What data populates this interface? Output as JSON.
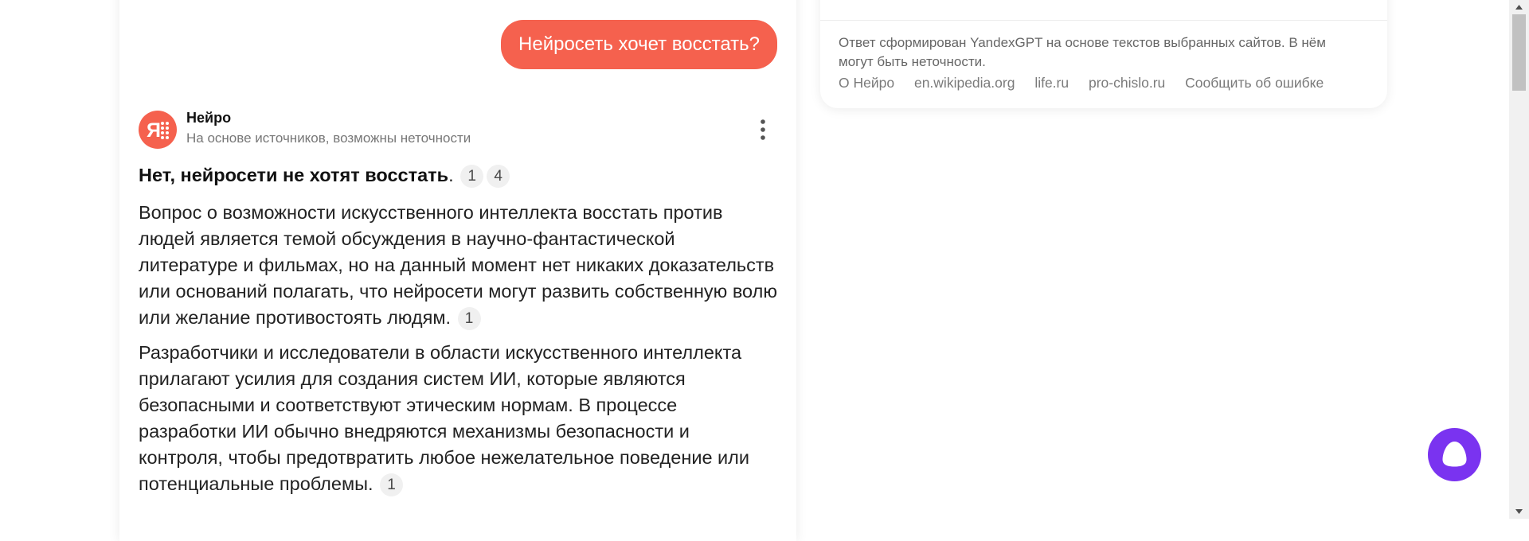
{
  "chat": {
    "user_question": "Нейросеть хочет восстать?",
    "author": {
      "name": "Нейро",
      "subtitle": "На основе источников, возможны неточности",
      "avatar_icon": "neuro-logo-icon",
      "more_icon": "more-vertical-icon"
    },
    "answer": {
      "lead_bold": "Нет, нейросети не хотят восстать",
      "lead_end": ".",
      "lead_citations": [
        "1",
        "4"
      ],
      "paragraphs": [
        {
          "text": "Вопрос о возможности искусственного интеллекта восстать против людей является темой обсуждения в научно-фантастической литературе и фильмах, но на данный момент нет никаких доказательств или оснований полагать, что нейросети могут развить собственную волю или желание противостоять людям.",
          "citation": "1"
        },
        {
          "text": "Разработчики и исследователи в области искусственного интеллекта прилагают усилия для создания систем ИИ, которые являются безопасными и соответствуют этическим нормам. В процессе разработки ИИ обычно внедряются механизмы безопасности и контроля, чтобы предотвратить любое нежелательное поведение или потенциальные проблемы.",
          "citation": "1"
        }
      ]
    }
  },
  "sources_panel": {
    "disclaimer": "Ответ сформирован YandexGPT на основе текстов выбранных сайтов. В нём могут быть неточности.",
    "links": [
      "О Нейро",
      "en.wikipedia.org",
      "life.ru",
      "pro-chislo.ru",
      "Сообщить об ошибке"
    ]
  },
  "alice_button": {
    "icon": "alice-icon"
  },
  "colors": {
    "accent": "#f5614e",
    "alice": "#7a33f0",
    "muted_text": "#777777"
  }
}
